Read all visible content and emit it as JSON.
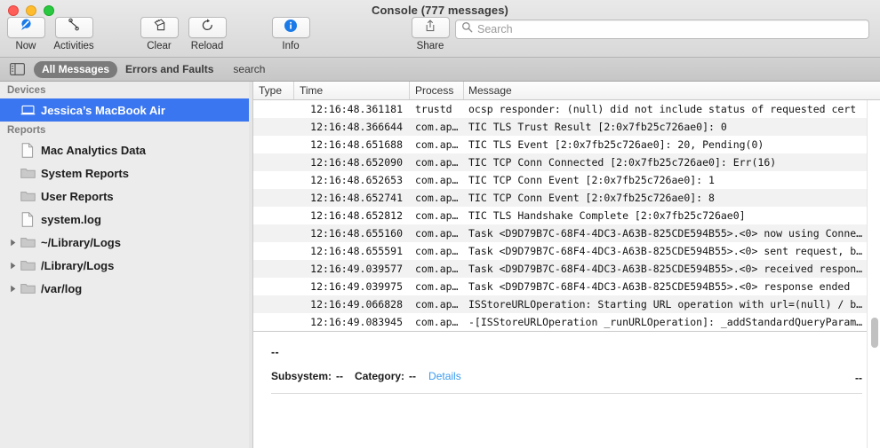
{
  "window": {
    "title": "Console (777 messages)",
    "traffic_lights": [
      "close",
      "minimize",
      "maximize"
    ]
  },
  "toolbar": {
    "items": [
      {
        "label": "Now",
        "icon": "now-magnifier-icon"
      },
      {
        "label": "Activities",
        "icon": "activities-icon"
      },
      {
        "label": "Clear",
        "icon": "clear-icon"
      },
      {
        "label": "Reload",
        "icon": "reload-icon"
      },
      {
        "label": "Info",
        "icon": "info-icon"
      },
      {
        "label": "Share",
        "icon": "share-icon"
      }
    ]
  },
  "search": {
    "value": "",
    "placeholder": "Search",
    "icon": "search-icon"
  },
  "filter_bar": {
    "sidebar_toggle_icon": "sidebar-toggle-icon",
    "segments": [
      {
        "label": "All Messages",
        "selected": true
      },
      {
        "label": "Errors and Faults",
        "selected": false
      }
    ],
    "search_label": "search"
  },
  "sidebar": {
    "sections": [
      {
        "header": "Devices",
        "items": [
          {
            "label": "Jessica’s MacBook Air",
            "icon": "laptop-icon",
            "selected": true,
            "disclosure": false
          }
        ]
      },
      {
        "header": "Reports",
        "items": [
          {
            "label": "Mac Analytics Data",
            "icon": "document-icon",
            "selected": false,
            "disclosure": false
          },
          {
            "label": "System Reports",
            "icon": "folder-icon",
            "selected": false,
            "disclosure": false
          },
          {
            "label": "User Reports",
            "icon": "folder-icon",
            "selected": false,
            "disclosure": false
          },
          {
            "label": "system.log",
            "icon": "document-icon",
            "selected": false,
            "disclosure": false
          },
          {
            "label": "~/Library/Logs",
            "icon": "folder-icon",
            "selected": false,
            "disclosure": true
          },
          {
            "label": "/Library/Logs",
            "icon": "folder-icon",
            "selected": false,
            "disclosure": true
          },
          {
            "label": "/var/log",
            "icon": "folder-icon",
            "selected": false,
            "disclosure": true
          }
        ]
      }
    ]
  },
  "table": {
    "columns": [
      {
        "label": "Type"
      },
      {
        "label": "Time"
      },
      {
        "label": "Process"
      },
      {
        "label": "Message"
      }
    ],
    "rows": [
      {
        "type": "",
        "time": "12:16:48.361181",
        "process": "trustd",
        "message": "ocsp responder: (null) did not include status of requested cert"
      },
      {
        "type": "",
        "time": "12:16:48.366644",
        "process": "com.ap…",
        "message": "TIC TLS Trust Result [2:0x7fb25c726ae0]: 0"
      },
      {
        "type": "",
        "time": "12:16:48.651688",
        "process": "com.ap…",
        "message": "TIC TLS Event [2:0x7fb25c726ae0]: 20, Pending(0)"
      },
      {
        "type": "",
        "time": "12:16:48.652090",
        "process": "com.ap…",
        "message": "TIC TCP Conn Connected [2:0x7fb25c726ae0]: Err(16)"
      },
      {
        "type": "",
        "time": "12:16:48.652653",
        "process": "com.ap…",
        "message": "TIC TCP Conn Event [2:0x7fb25c726ae0]: 1"
      },
      {
        "type": "",
        "time": "12:16:48.652741",
        "process": "com.ap…",
        "message": "TIC TCP Conn Event [2:0x7fb25c726ae0]: 8"
      },
      {
        "type": "",
        "time": "12:16:48.652812",
        "process": "com.ap…",
        "message": "TIC TLS Handshake Complete [2:0x7fb25c726ae0]"
      },
      {
        "type": "",
        "time": "12:16:48.655160",
        "process": "com.ap…",
        "message": "Task <D9D79B7C-68F4-4DC3-A63B-825CDE594B55>.<0> now using Conne…"
      },
      {
        "type": "",
        "time": "12:16:48.655591",
        "process": "com.ap…",
        "message": "Task <D9D79B7C-68F4-4DC3-A63B-825CDE594B55>.<0> sent request, b…"
      },
      {
        "type": "",
        "time": "12:16:49.039577",
        "process": "com.ap…",
        "message": "Task <D9D79B7C-68F4-4DC3-A63B-825CDE594B55>.<0> received respon…"
      },
      {
        "type": "",
        "time": "12:16:49.039975",
        "process": "com.ap…",
        "message": "Task <D9D79B7C-68F4-4DC3-A63B-825CDE594B55>.<0> response ended"
      },
      {
        "type": "",
        "time": "12:16:49.066828",
        "process": "com.ap…",
        "message": "ISStoreURLOperation: Starting URL operation with url=(null) / b…"
      },
      {
        "type": "",
        "time": "12:16:49.083945",
        "process": "com.ap…",
        "message": "-[ISStoreURLOperation _runURLOperation]: _addStandardQueryParam…"
      }
    ]
  },
  "detail": {
    "message": "--",
    "subsystem_label": "Subsystem:",
    "subsystem_value": "--",
    "category_label": "Category:",
    "category_value": "--",
    "details_link": "Details",
    "right_value": "--"
  },
  "colors": {
    "selection": "#3a76f0",
    "link": "#3a9bf0",
    "segment_active_bg": "#7b7b7b",
    "row_alt": "#f2f2f2",
    "info_blue": "#1a7ae8"
  }
}
